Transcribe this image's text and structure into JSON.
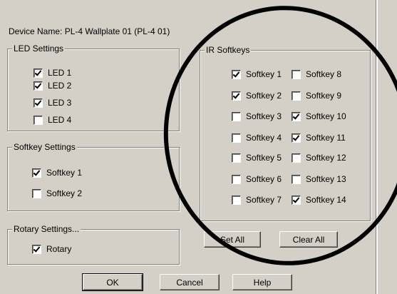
{
  "device_name": "Device Name: PL-4 Wallplate 01 (PL-4 01)",
  "led_settings": {
    "title": "LED Settings",
    "items": [
      {
        "label": "LED 1",
        "checked": true
      },
      {
        "label": "LED 2",
        "checked": true
      },
      {
        "label": "LED 3",
        "checked": true
      },
      {
        "label": "LED 4",
        "checked": false
      }
    ]
  },
  "softkey_settings": {
    "title": "Softkey Settings",
    "items": [
      {
        "label": "Softkey 1",
        "checked": true
      },
      {
        "label": "Softkey 2",
        "checked": false
      }
    ]
  },
  "rotary_settings": {
    "title": "Rotary Settings...",
    "items": [
      {
        "label": "Rotary",
        "checked": true
      }
    ]
  },
  "ir_softkeys": {
    "title": "IR Softkeys",
    "left": [
      {
        "label": "Softkey 1",
        "checked": true
      },
      {
        "label": "Softkey 2",
        "checked": true
      },
      {
        "label": "Softkey 3",
        "checked": false
      },
      {
        "label": "Softkey 4",
        "checked": false
      },
      {
        "label": "Softkey 5",
        "checked": false
      },
      {
        "label": "Softkey 6",
        "checked": false
      },
      {
        "label": "Softkey 7",
        "checked": false
      }
    ],
    "right": [
      {
        "label": "Softkey 8",
        "checked": false
      },
      {
        "label": "Softkey 9",
        "checked": false
      },
      {
        "label": "Softkey 10",
        "checked": true
      },
      {
        "label": "Softkey 11",
        "checked": true
      },
      {
        "label": "Softkey 12",
        "checked": false
      },
      {
        "label": "Softkey 13",
        "checked": false
      },
      {
        "label": "Softkey 14",
        "checked": true
      }
    ],
    "set_all_label": "Set All",
    "clear_all_label": "Clear All"
  },
  "footer": {
    "ok_label": "OK",
    "cancel_label": "Cancel",
    "help_label": "Help"
  },
  "colors": {
    "dialog_bg": "#d4d0c8",
    "annotation": "#000000"
  }
}
